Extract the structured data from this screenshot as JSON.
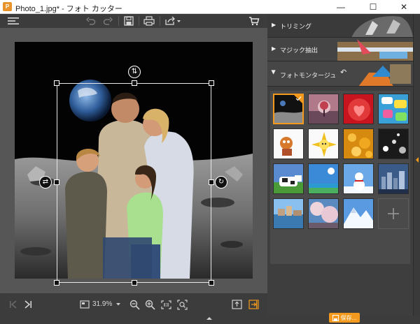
{
  "window": {
    "title": "Photo_1.jpg* - フォト カッター",
    "app_icon": "app-icon"
  },
  "toolbar": {
    "icons": [
      "menu-icon",
      "undo-icon",
      "redo-icon",
      "save-icon",
      "print-icon",
      "share-icon",
      "cart-icon"
    ]
  },
  "canvas": {
    "handles": [
      "handle-tl",
      "handle-tm",
      "handle-tr",
      "handle-ml",
      "handle-mr",
      "handle-bl",
      "handle-bm",
      "handle-br"
    ]
  },
  "bottombar": {
    "zoom": "31.9%",
    "icons": [
      "first-page-icon",
      "next-page-icon",
      "fit-screen-icon",
      "zoom-dropdown-icon",
      "zoom-out-icon",
      "zoom-in-icon",
      "actual-size-icon",
      "fit-icon",
      "export-icon",
      "import-icon"
    ]
  },
  "panel": {
    "sections": [
      {
        "label": "トリミング",
        "expanded": false
      },
      {
        "label": "マジック抽出",
        "expanded": false
      },
      {
        "label": "フォトモンタージュ",
        "expanded": true
      }
    ],
    "thumbnails": [
      {
        "name": "moon-background",
        "selected": true
      },
      {
        "name": "tree-sunset-background",
        "selected": false
      },
      {
        "name": "red-heart-background",
        "selected": false
      },
      {
        "name": "comic-speech-background",
        "selected": false
      },
      {
        "name": "fox-cartoon-background",
        "selected": false
      },
      {
        "name": "bee-cartoon-background",
        "selected": false
      },
      {
        "name": "gold-bokeh-background",
        "selected": false
      },
      {
        "name": "dark-lights-background",
        "selected": false
      },
      {
        "name": "cow-field-background",
        "selected": false
      },
      {
        "name": "beach-sky-background",
        "selected": false
      },
      {
        "name": "snowman-background",
        "selected": false
      },
      {
        "name": "city-skyline-background",
        "selected": false
      },
      {
        "name": "venice-background",
        "selected": false
      },
      {
        "name": "cherry-blossom-background",
        "selected": false
      },
      {
        "name": "snowy-mountain-background",
        "selected": false
      },
      {
        "name": "add-background",
        "selected": false
      }
    ],
    "save_label": "保存..."
  },
  "colors": {
    "accent": "#f39a1e",
    "panel": "#3e3e3e",
    "canvas": "#565656"
  }
}
